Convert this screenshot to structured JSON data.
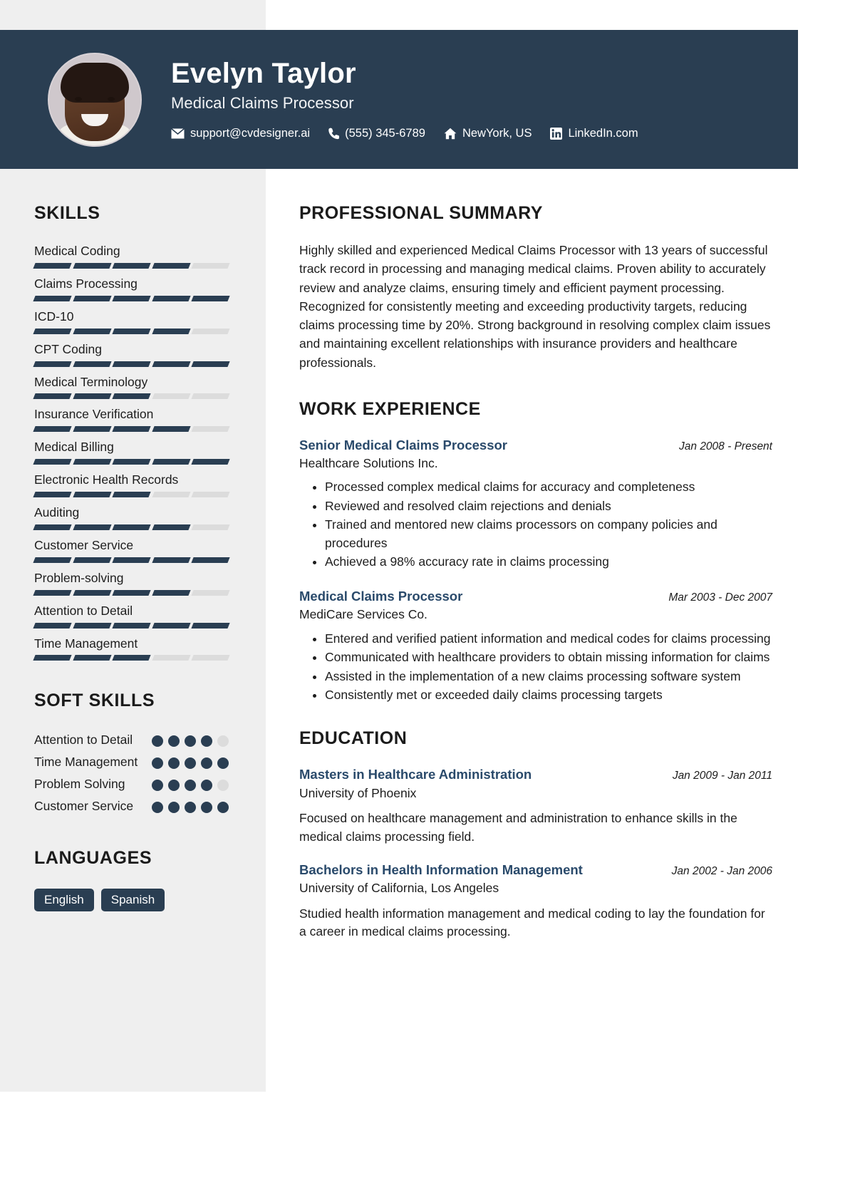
{
  "header": {
    "name": "Evelyn Taylor",
    "job_title": "Medical Claims Processor",
    "contacts": [
      {
        "icon": "envelope-icon",
        "text": "support@cvdesigner.ai"
      },
      {
        "icon": "phone-icon",
        "text": "(555) 345-6789"
      },
      {
        "icon": "home-icon",
        "text": "NewYork, US"
      },
      {
        "icon": "linkedin-icon",
        "text": "LinkedIn.com"
      }
    ],
    "background_color": "#2a3e52"
  },
  "sidebar": {
    "skills_heading": "SKILLS",
    "skills": [
      {
        "name": "Medical Coding",
        "level": 4,
        "max": 5
      },
      {
        "name": "Claims Processing",
        "level": 5,
        "max": 5
      },
      {
        "name": "ICD-10",
        "level": 4,
        "max": 5
      },
      {
        "name": "CPT Coding",
        "level": 5,
        "max": 5
      },
      {
        "name": "Medical Terminology",
        "level": 3,
        "max": 5
      },
      {
        "name": "Insurance Verification",
        "level": 4,
        "max": 5
      },
      {
        "name": "Medical Billing",
        "level": 5,
        "max": 5
      },
      {
        "name": "Electronic Health Records",
        "level": 3,
        "max": 5
      },
      {
        "name": "Auditing",
        "level": 4,
        "max": 5
      },
      {
        "name": "Customer Service",
        "level": 5,
        "max": 5
      },
      {
        "name": "Problem-solving",
        "level": 4,
        "max": 5
      },
      {
        "name": "Attention to Detail",
        "level": 5,
        "max": 5
      },
      {
        "name": "Time Management",
        "level": 3,
        "max": 5
      }
    ],
    "soft_skills_heading": "SOFT SKILLS",
    "soft_skills": [
      {
        "name": "Attention to Detail",
        "level": 4,
        "max": 5
      },
      {
        "name": "Time Management",
        "level": 5,
        "max": 5
      },
      {
        "name": "Problem Solving",
        "level": 4,
        "max": 5
      },
      {
        "name": "Customer Service",
        "level": 5,
        "max": 5
      }
    ],
    "languages_heading": "LANGUAGES",
    "languages": [
      "English",
      "Spanish"
    ],
    "accent_color": "#2a3e52",
    "track_color": "#dcdcdc",
    "background_color": "#efefef"
  },
  "main": {
    "summary_heading": "PROFESSIONAL SUMMARY",
    "summary_text": "Highly skilled and experienced Medical Claims Processor with 13 years of successful track record in processing and managing medical claims. Proven ability to accurately review and analyze claims, ensuring timely and efficient payment processing. Recognized for consistently meeting and exceeding productivity targets, reducing claims processing time by 20%. Strong background in resolving complex claim issues and maintaining excellent relationships with insurance providers and healthcare professionals.",
    "experience_heading": "WORK EXPERIENCE",
    "experience": [
      {
        "title": "Senior Medical Claims Processor",
        "date": "Jan 2008 - Present",
        "organization": "Healthcare Solutions Inc.",
        "bullets": [
          "Processed complex medical claims for accuracy and completeness",
          "Reviewed and resolved claim rejections and denials",
          "Trained and mentored new claims processors on company policies and procedures",
          "Achieved a 98% accuracy rate in claims processing"
        ]
      },
      {
        "title": "Medical Claims Processor",
        "date": "Mar 2003 - Dec 2007",
        "organization": "MediCare Services Co.",
        "bullets": [
          "Entered and verified patient information and medical codes for claims processing",
          "Communicated with healthcare providers to obtain missing information for claims",
          "Assisted in the implementation of a new claims processing software system",
          "Consistently met or exceeded daily claims processing targets"
        ]
      }
    ],
    "education_heading": "EDUCATION",
    "education": [
      {
        "degree": "Masters in Healthcare Administration",
        "date": "Jan 2009 - Jan 2011",
        "school": "University of Phoenix",
        "description": "Focused on healthcare management and administration to enhance skills in the medical claims processing field."
      },
      {
        "degree": "Bachelors in Health Information Management",
        "date": "Jan 2002 - Jan 2006",
        "school": "University of California, Los Angeles",
        "description": "Studied health information management and medical coding to lay the foundation for a career in medical claims processing."
      }
    ],
    "title_color": "#2a4a6b"
  }
}
